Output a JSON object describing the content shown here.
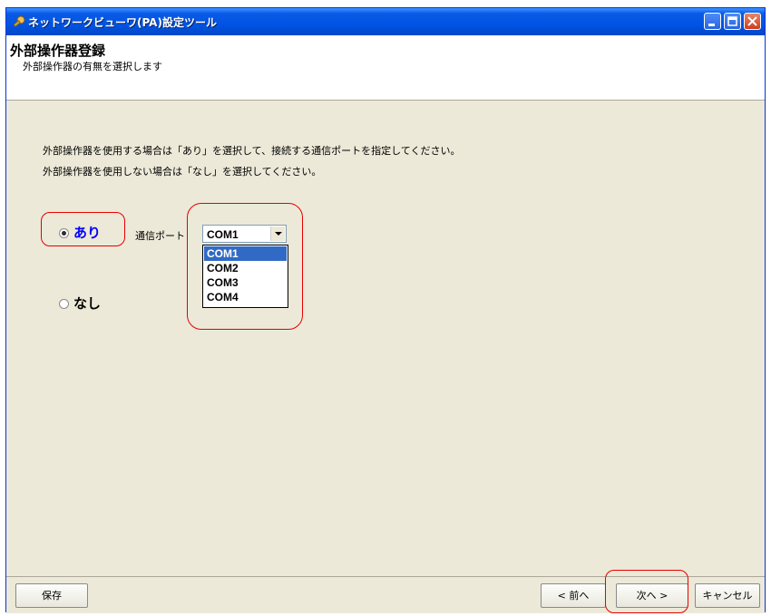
{
  "window": {
    "title": "ネットワークビューワ(PA)設定ツール"
  },
  "header": {
    "title": "外部操作器登録",
    "subtitle": "外部操作器の有無を選択します"
  },
  "instructions": [
    "外部操作器を使用する場合は「あり」を選択して、接続する通信ポートを指定してください。",
    "外部操作器を使用しない場合は「なし」を選択してください。"
  ],
  "options": {
    "yes_label": "あり",
    "no_label": "なし",
    "selected": "あり"
  },
  "port": {
    "label": "通信ポート",
    "value": "COM1",
    "items": [
      "COM1",
      "COM2",
      "COM3",
      "COM4"
    ],
    "highlighted_item": "COM1"
  },
  "buttons": {
    "save": "保存",
    "back": "< 前へ",
    "next": "次へ >",
    "cancel": "キャンセル"
  },
  "colors": {
    "titlebar": "#0054e3",
    "highlight_ring": "#e80000",
    "yes_label_color": "#0000ff",
    "list_selection": "#316ac5"
  }
}
